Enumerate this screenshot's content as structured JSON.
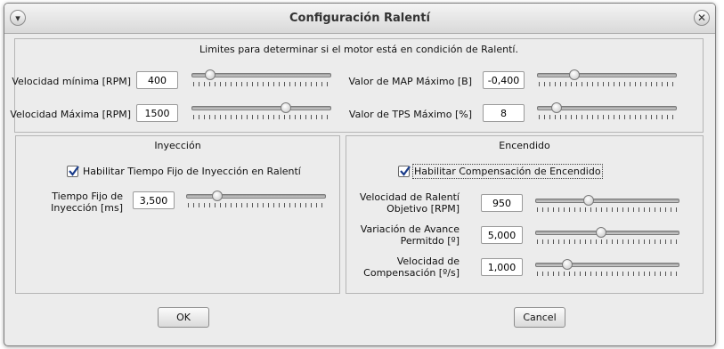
{
  "window": {
    "title": "Configuración Ralentí"
  },
  "limits": {
    "caption": "Limites para determinar si el motor está en condición de Ralentí.",
    "vel_min": {
      "label": "Velocidad mínima [RPM]",
      "value": "400",
      "slider_fraction": 0.1
    },
    "vel_max": {
      "label": "Velocidad Máxima [RPM]",
      "value": "1500",
      "slider_fraction": 0.69
    },
    "map_max": {
      "label": "Valor de MAP Máximo [B]",
      "value": "-0,400",
      "slider_fraction": 0.25
    },
    "tps_max": {
      "label": "Valor de TPS Máximo [%]",
      "value": "8",
      "slider_fraction": 0.11
    }
  },
  "injection": {
    "title": "Inyección",
    "enable_label": "Habilitar Tiempo Fijo de Inyección en Ralentí",
    "enable_checked": true,
    "fixed_time": {
      "label_line1": "Tiempo Fijo de",
      "label_line2": "Inyección [ms]",
      "value": "3,500",
      "slider_fraction": 0.2
    }
  },
  "ignition": {
    "title": "Encendido",
    "enable_label": "Habilitar Compensación de Encendido",
    "enable_checked": true,
    "target_speed": {
      "label_line1": "Velocidad de Ralentí",
      "label_line2": "Objetivo [RPM]",
      "value": "950",
      "slider_fraction": 0.36
    },
    "advance_variation": {
      "label_line1": "Variación de Avance",
      "label_line2": "Permitdo [º]",
      "value": "5,000",
      "slider_fraction": 0.45
    },
    "comp_speed": {
      "label_line1": "Velocidad de",
      "label_line2": "Compensación [º/s]",
      "value": "1,000",
      "slider_fraction": 0.2
    }
  },
  "buttons": {
    "ok": "OK",
    "cancel": "Cancel"
  }
}
